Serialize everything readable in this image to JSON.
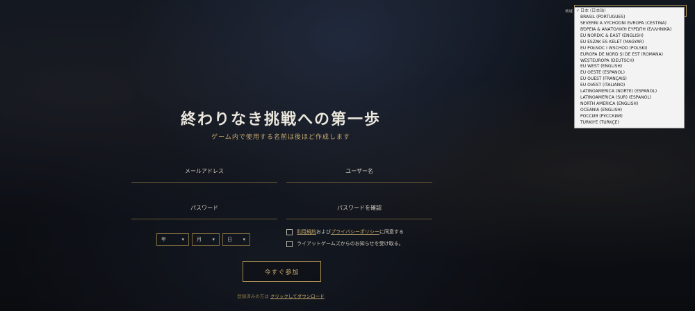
{
  "hero": {
    "title": "終わりなき挑戦への第一歩",
    "subtitle": "ゲーム内で使用する名前は後ほど作成します"
  },
  "form": {
    "email_label": "メールアドレス",
    "username_label": "ユーザー名",
    "password_label": "パスワード",
    "confirm_label": "パスワードを確認",
    "birthdate": {
      "year": "年",
      "month": "月",
      "day": "日"
    },
    "terms": {
      "link1": "利用規約",
      "mid": "および",
      "link2": "プライバシーポリシー",
      "end": "に同意する"
    },
    "news_label": "ライアットゲームズからのお知らせを受け取る。",
    "submit_label": "今すぐ参加"
  },
  "footer": {
    "prefix": "登録済みの方は",
    "link": "クリックしてダウンロード"
  },
  "region": {
    "label": "地域",
    "selected": "日本 (日本語)",
    "options": [
      "日本 (日本語)",
      "BRASIL (PORTUGUÊS)",
      "SEVERNÍ A VÝCHODNÍ EVROPA (ČEŠTINA)",
      "ΒΌΡΕΙΑ & ΑΝΑΤΟΛΙΚΉ ΕΥΡΏΠΗ (ΕΛΛΗΝΙΚΆ)",
      "EU NORDIC & EAST (ENGLISH)",
      "EU ÉSZAK ÉS KELET (MAGYAR)",
      "EU PÓŁNOC I WSCHÓD (POLSKI)",
      "EUROPA DE NORD ȘI DE EST (ROMÂNĂ)",
      "WESTEUROPA (DEUTSCH)",
      "EU WEST (ENGLISH)",
      "EU OESTE (ESPAÑOL)",
      "EU OUEST (FRANÇAIS)",
      "EU OVEST (ITALIANO)",
      "LATINOAMÉRICA (NORTE) (ESPAÑOL)",
      "LATINOAMÉRICA (SUR) (ESPAÑOL)",
      "NORTH AMERICA (ENGLISH)",
      "OCEANIA (ENGLISH)",
      "РОССИЯ (РУССКИЙ)",
      "TÜRKIYE (TÜRKÇE)"
    ]
  },
  "colors": {
    "accent_gold": "#c8aa6e",
    "border_gold": "#7d6a3e",
    "dropdown_bg": "#f3f3f3"
  },
  "icons": {
    "select_arrow": "chevron-down-icon",
    "checkmark": "check-icon"
  }
}
